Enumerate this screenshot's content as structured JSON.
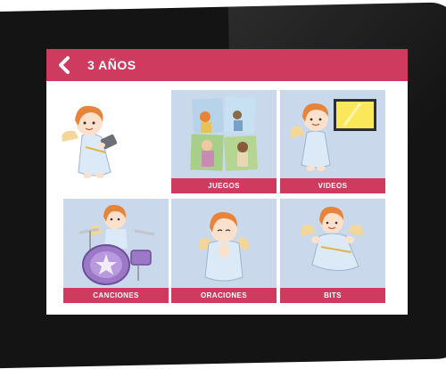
{
  "header": {
    "title": "3 AÑOS",
    "back_icon": "chevron-left-icon"
  },
  "colors": {
    "accent": "#cf3b5f",
    "tile_bg": "#c9d8ea",
    "hair": "#e8843a",
    "robe": "#dce9f6"
  },
  "tiles": [
    {
      "label": "JUEGOS",
      "icon": "puzzle-icon"
    },
    {
      "label": "VIDEOS",
      "icon": "tv-screen-icon"
    },
    {
      "label": "CANCIONES",
      "icon": "drum-kit-icon"
    },
    {
      "label": "ORACIONES",
      "icon": "praying-angel-icon"
    },
    {
      "label": "BITS",
      "icon": "flying-angel-icon"
    }
  ]
}
